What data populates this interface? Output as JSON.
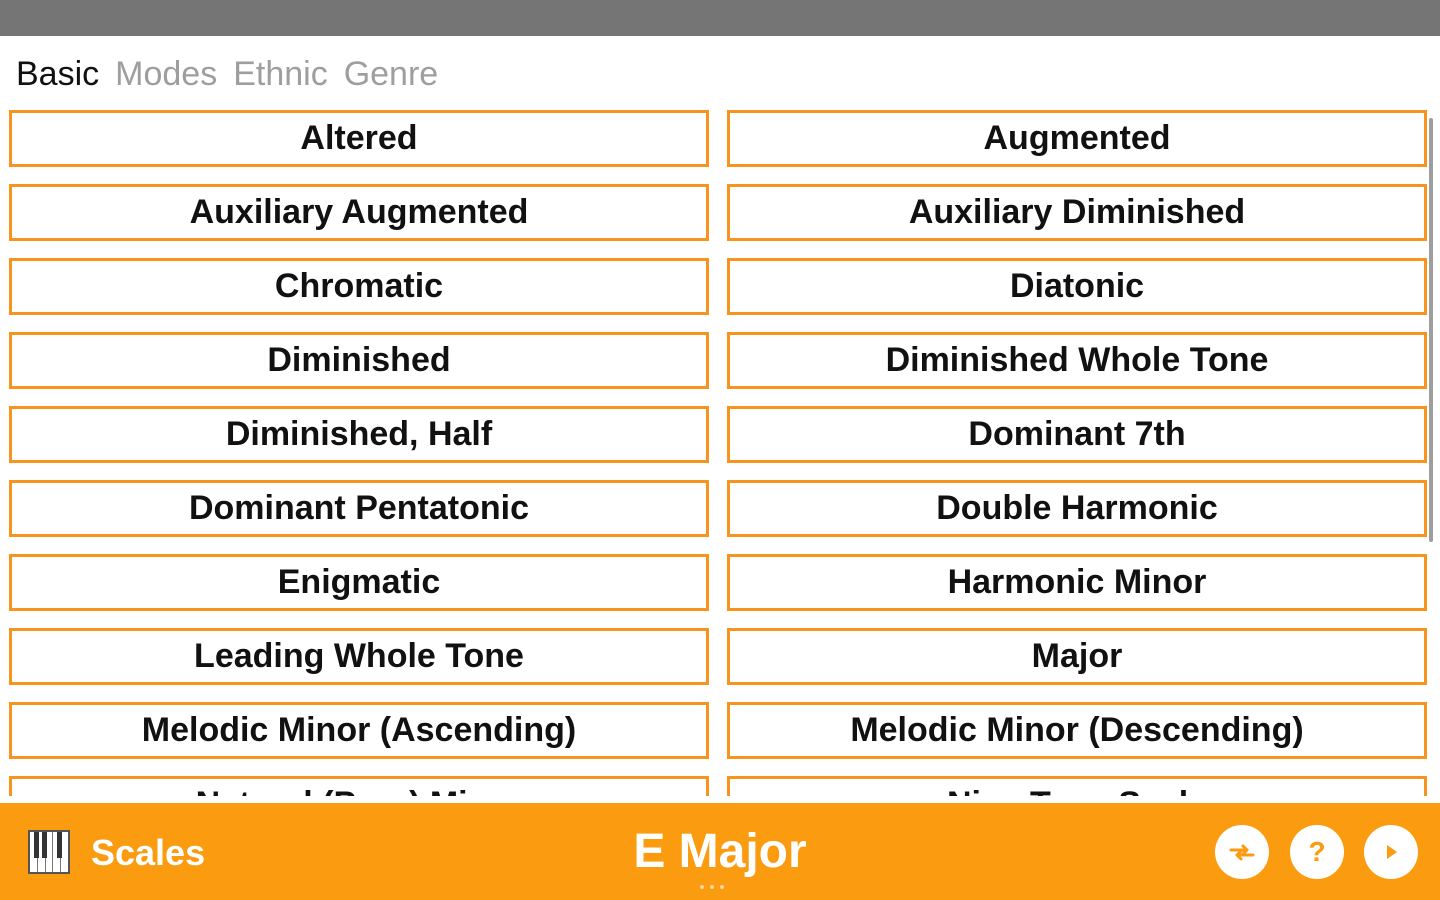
{
  "tabs": [
    {
      "label": "Basic",
      "active": true
    },
    {
      "label": "Modes",
      "active": false
    },
    {
      "label": "Ethnic",
      "active": false
    },
    {
      "label": "Genre",
      "active": false
    }
  ],
  "scales": [
    "Altered",
    "Augmented",
    "Auxiliary Augmented",
    "Auxiliary Diminished",
    "Chromatic",
    "Diatonic",
    "Diminished",
    "Diminished Whole Tone",
    "Diminished, Half",
    "Dominant 7th",
    "Dominant Pentatonic",
    "Double Harmonic",
    "Enigmatic",
    "Harmonic Minor",
    "Leading Whole Tone",
    "Major",
    "Melodic Minor (Ascending)",
    "Melodic Minor (Descending)",
    "Natural (Pure) Minor",
    "Nine Tone Scale"
  ],
  "bottom_bar": {
    "section_label": "Scales",
    "current_scale": "E Major",
    "help_label": "?",
    "icons": {
      "section": "piano-icon",
      "swap": "swap-arrows-icon",
      "help": "help-icon",
      "play": "play-icon"
    }
  },
  "colors": {
    "accent": "#fb9b10",
    "button_border": "#f6941e",
    "status_bar": "#757575",
    "tab_inactive": "#9e9e9e"
  }
}
